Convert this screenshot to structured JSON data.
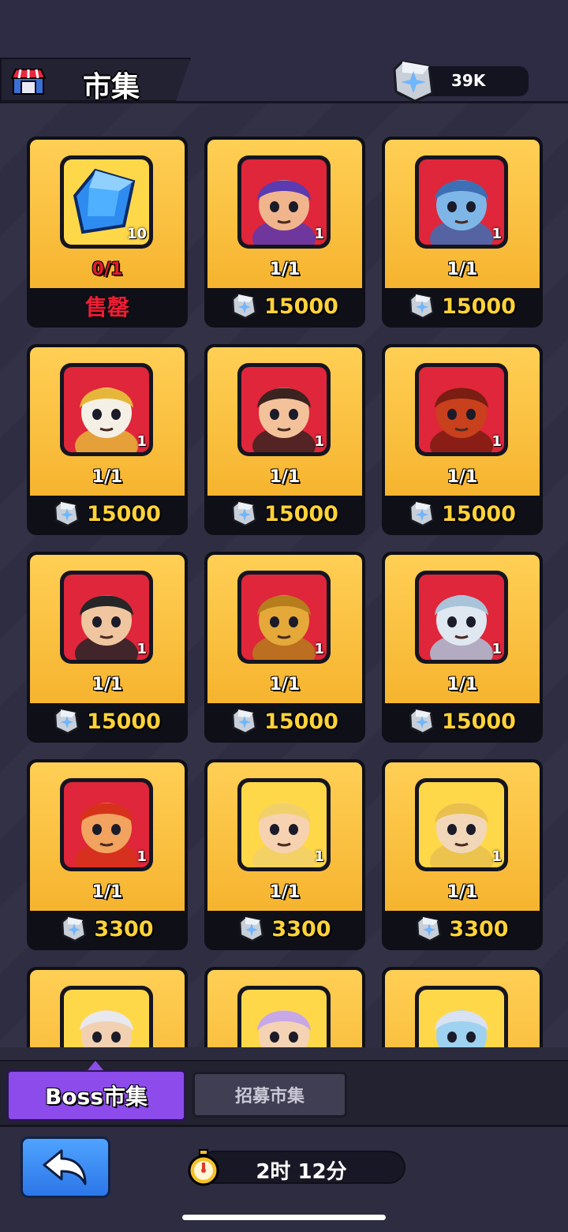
{
  "header": {
    "title": "市集",
    "shop_icon": "shop-stall-icon",
    "currency": {
      "icon": "crystal-gem-icon",
      "amount": "39K"
    }
  },
  "colors": {
    "card_gold": "#f6b42f",
    "price_yellow": "#ffd23a",
    "soldout_red": "#ec1f35",
    "tab_purple": "#8c4bea"
  },
  "items": [
    {
      "name": "blue-gem",
      "qty": "10",
      "stock": "0/1",
      "price": "售罄",
      "soldout": true,
      "bg": "#ffd84a",
      "skin": "#3fa7ff",
      "hair": "#1e5fd1"
    },
    {
      "name": "hero-purple-hair",
      "qty": "1",
      "stock": "1/1",
      "price": "15000",
      "soldout": false,
      "bg": "#e0263a",
      "skin": "#f1b58e",
      "hair": "#5a3bb0"
    },
    {
      "name": "hero-ice-knight",
      "qty": "1",
      "stock": "1/1",
      "price": "15000",
      "soldout": false,
      "bg": "#e0263a",
      "skin": "#7fb6e8",
      "hair": "#3d6fb5"
    },
    {
      "name": "hero-pharaoh-robot",
      "qty": "1",
      "stock": "1/1",
      "price": "15000",
      "soldout": false,
      "bg": "#e0263a",
      "skin": "#f4f0e6",
      "hair": "#e6b63a"
    },
    {
      "name": "hero-dark-hair",
      "qty": "1",
      "stock": "1/1",
      "price": "15000",
      "soldout": false,
      "bg": "#e0263a",
      "skin": "#f3c29b",
      "hair": "#3b2320"
    },
    {
      "name": "hero-lava-golem",
      "qty": "1",
      "stock": "1/1",
      "price": "15000",
      "soldout": false,
      "bg": "#e0263a",
      "skin": "#c9401c",
      "hair": "#7a1d12"
    },
    {
      "name": "hero-masked-bandit",
      "qty": "1",
      "stock": "1/1",
      "price": "15000",
      "soldout": false,
      "bg": "#e0263a",
      "skin": "#f0c6a0",
      "hair": "#262628"
    },
    {
      "name": "hero-gold-robot",
      "qty": "1",
      "stock": "1/1",
      "price": "15000",
      "soldout": false,
      "bg": "#e0263a",
      "skin": "#e5a93a",
      "hair": "#b57d1c"
    },
    {
      "name": "hero-ice-maiden",
      "qty": "1",
      "stock": "1/1",
      "price": "15000",
      "soldout": false,
      "bg": "#e0263a",
      "skin": "#dfe7f1",
      "hair": "#a9c3d9"
    },
    {
      "name": "hero-fire-warrior",
      "qty": "1",
      "stock": "1/1",
      "price": "3300",
      "soldout": false,
      "bg": "#e0263a",
      "skin": "#f2a35f",
      "hair": "#d6321b"
    },
    {
      "name": "hero-blonde-priestess",
      "qty": "1",
      "stock": "1/1",
      "price": "3300",
      "soldout": false,
      "bg": "#ffd84a",
      "skin": "#f6d2b0",
      "hair": "#f2d069"
    },
    {
      "name": "hero-vampire",
      "qty": "1",
      "stock": "1/1",
      "price": "3300",
      "soldout": false,
      "bg": "#ffd84a",
      "skin": "#f1d7b8",
      "hair": "#e9c04d"
    },
    {
      "name": "hero-white-sage",
      "qty": "",
      "stock": "",
      "price": "",
      "soldout": false,
      "bg": "#ffd84a",
      "skin": "#f2d1b3",
      "hair": "#e8e8ef"
    },
    {
      "name": "hero-valkyrie",
      "qty": "",
      "stock": "",
      "price": "",
      "soldout": false,
      "bg": "#ffd84a",
      "skin": "#f4d2b4",
      "hair": "#c7a8e6"
    },
    {
      "name": "hero-frost-witch",
      "qty": "",
      "stock": "",
      "price": "",
      "soldout": false,
      "bg": "#ffd84a",
      "skin": "#9ed2f0",
      "hair": "#d8e2f2"
    }
  ],
  "tabs": [
    {
      "label": "Boss市集",
      "active": true
    },
    {
      "label": "招募市集",
      "active": false
    }
  ],
  "footer": {
    "back_icon": "back-arrow-icon",
    "timer_icon": "stopwatch-icon",
    "timer_text": "2时 12分"
  }
}
